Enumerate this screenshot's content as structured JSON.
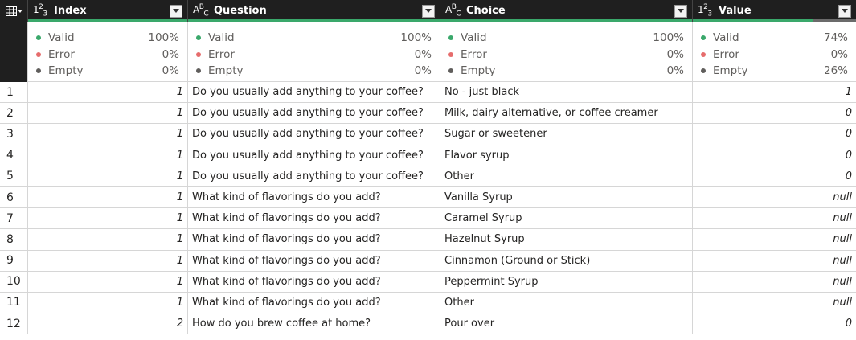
{
  "columns": [
    {
      "name": "Index",
      "type_icon": "123",
      "type": "number",
      "valid": "100%",
      "error": "0%",
      "empty": "0%",
      "valid_ratio": 1.0
    },
    {
      "name": "Question",
      "type_icon": "ABC",
      "type": "text",
      "valid": "100%",
      "error": "0%",
      "empty": "0%",
      "valid_ratio": 1.0
    },
    {
      "name": "Choice",
      "type_icon": "ABC",
      "type": "text",
      "valid": "100%",
      "error": "0%",
      "empty": "0%",
      "valid_ratio": 1.0
    },
    {
      "name": "Value",
      "type_icon": "123",
      "type": "number",
      "valid": "74%",
      "error": "0%",
      "empty": "26%",
      "valid_ratio": 0.74
    }
  ],
  "profile_labels": {
    "valid": "Valid",
    "error": "Error",
    "empty": "Empty"
  },
  "colors": {
    "valid": "#3aa86b",
    "error": "#e66c6c",
    "empty": "#605e5c",
    "header_bg": "#1f1f1f"
  },
  "rows": [
    {
      "n": "1",
      "index": "1",
      "question": "Do you usually add anything to your coffee?",
      "choice": "No - just black",
      "value": "1"
    },
    {
      "n": "2",
      "index": "1",
      "question": "Do you usually add anything to your coffee?",
      "choice": "Milk, dairy alternative, or coffee creamer",
      "value": "0"
    },
    {
      "n": "3",
      "index": "1",
      "question": "Do you usually add anything to your coffee?",
      "choice": "Sugar or sweetener",
      "value": "0"
    },
    {
      "n": "4",
      "index": "1",
      "question": "Do you usually add anything to your coffee?",
      "choice": "Flavor syrup",
      "value": "0"
    },
    {
      "n": "5",
      "index": "1",
      "question": "Do you usually add anything to your coffee?",
      "choice": "Other",
      "value": "0"
    },
    {
      "n": "6",
      "index": "1",
      "question": "What kind of flavorings do you add?",
      "choice": "Vanilla Syrup",
      "value": "null"
    },
    {
      "n": "7",
      "index": "1",
      "question": "What kind of flavorings do you add?",
      "choice": "Caramel Syrup",
      "value": "null"
    },
    {
      "n": "8",
      "index": "1",
      "question": "What kind of flavorings do you add?",
      "choice": "Hazelnut Syrup",
      "value": "null"
    },
    {
      "n": "9",
      "index": "1",
      "question": "What kind of flavorings do you add?",
      "choice": "Cinnamon (Ground or Stick)",
      "value": "null"
    },
    {
      "n": "10",
      "index": "1",
      "question": "What kind of flavorings do you add?",
      "choice": "Peppermint Syrup",
      "value": "null"
    },
    {
      "n": "11",
      "index": "1",
      "question": "What kind of flavorings do you add?",
      "choice": "Other",
      "value": "null"
    },
    {
      "n": "12",
      "index": "2",
      "question": "How do you brew coffee at home?",
      "choice": "Pour over",
      "value": "0"
    }
  ]
}
